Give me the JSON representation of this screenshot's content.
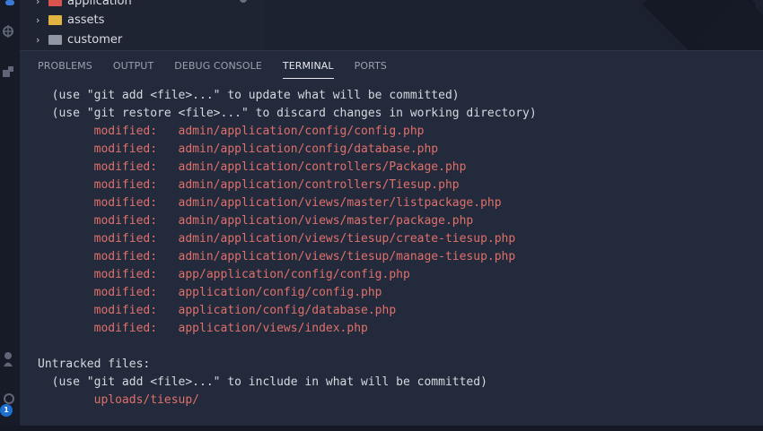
{
  "explorer": {
    "items": [
      {
        "label": "application",
        "folder_color": "#d9534f"
      },
      {
        "label": "assets",
        "folder_color": "#e3b341"
      },
      {
        "label": "customer",
        "folder_color": "#9097a3"
      }
    ]
  },
  "activity": {
    "badge": "1"
  },
  "panel": {
    "tabs": [
      {
        "label": "PROBLEMS"
      },
      {
        "label": "OUTPUT"
      },
      {
        "label": "DEBUG CONSOLE"
      },
      {
        "label": "TERMINAL",
        "active": true
      },
      {
        "label": "PORTS"
      }
    ]
  },
  "terminal": {
    "lines": [
      {
        "text": "  (use \"git add <file>...\" to update what will be committed)",
        "color": "normal"
      },
      {
        "text": "  (use \"git restore <file>...\" to discard changes in working directory)",
        "color": "normal"
      },
      {
        "text": "        modified:   admin/application/config/config.php",
        "color": "red"
      },
      {
        "text": "        modified:   admin/application/config/database.php",
        "color": "red"
      },
      {
        "text": "        modified:   admin/application/controllers/Package.php",
        "color": "red"
      },
      {
        "text": "        modified:   admin/application/controllers/Tiesup.php",
        "color": "red"
      },
      {
        "text": "        modified:   admin/application/views/master/listpackage.php",
        "color": "red"
      },
      {
        "text": "        modified:   admin/application/views/master/package.php",
        "color": "red"
      },
      {
        "text": "        modified:   admin/application/views/tiesup/create-tiesup.php",
        "color": "red"
      },
      {
        "text": "        modified:   admin/application/views/tiesup/manage-tiesup.php",
        "color": "red"
      },
      {
        "text": "        modified:   app/application/config/config.php",
        "color": "red"
      },
      {
        "text": "        modified:   application/config/config.php",
        "color": "red"
      },
      {
        "text": "        modified:   application/config/database.php",
        "color": "red"
      },
      {
        "text": "        modified:   application/views/index.php",
        "color": "red"
      },
      {
        "text": "",
        "color": "normal"
      },
      {
        "text": "Untracked files:",
        "color": "normal"
      },
      {
        "text": "  (use \"git add <file>...\" to include in what will be committed)",
        "color": "normal"
      },
      {
        "text": "        uploads/tiesup/",
        "color": "red"
      }
    ]
  }
}
